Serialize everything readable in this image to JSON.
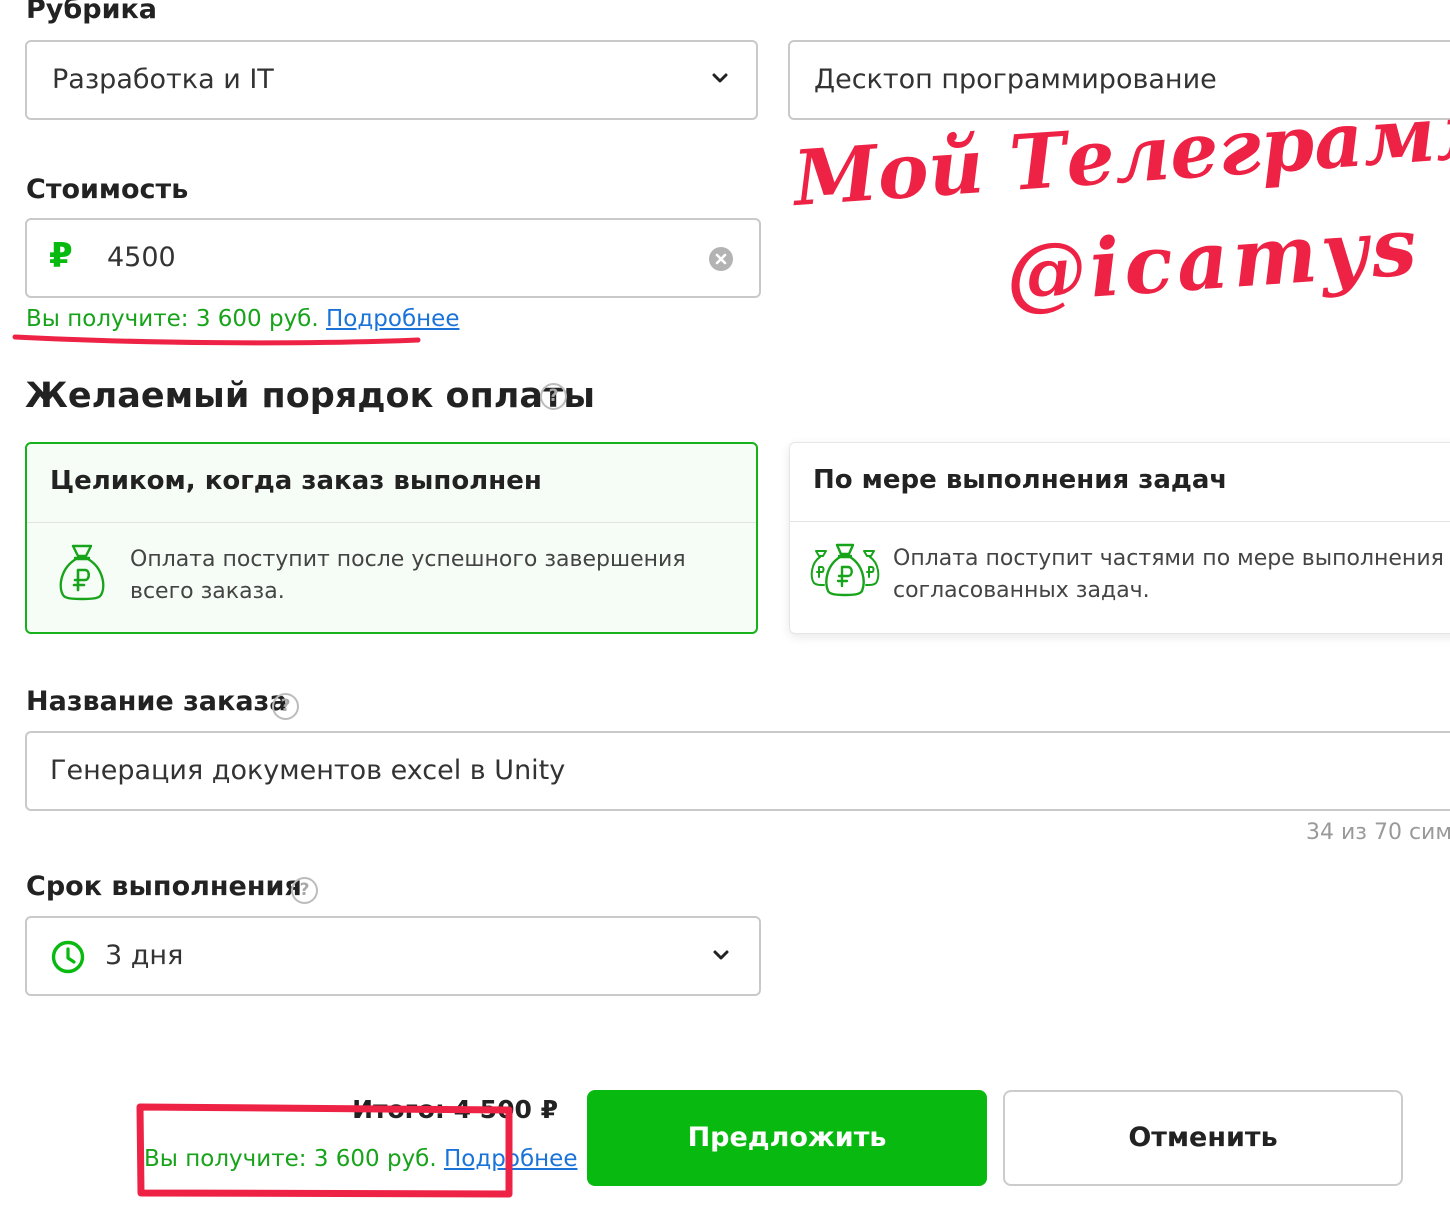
{
  "category": {
    "label": "Рубрика",
    "main_value": "Разработка и IT",
    "sub_value": "Десктоп программирование"
  },
  "price": {
    "label": "Стоимость",
    "currency_symbol": "₽",
    "value": "4500",
    "receive_text": "Вы получите: 3 600 руб.",
    "details_link": "Подробнее"
  },
  "payment": {
    "title": "Желаемый порядок оплаты",
    "help": "?",
    "options": [
      {
        "title": "Целиком, когда заказ выполнен",
        "description": "Оплата поступит после успешного завершения всего заказа.",
        "icon": "money-bag-icon",
        "selected": true
      },
      {
        "title": "По мере выполнения задач",
        "description": "Оплата поступит частями по мере выполнения согласованных задач.",
        "icon": "money-bags-icon",
        "selected": false
      }
    ]
  },
  "order_name": {
    "label": "Название заказа",
    "help": "?",
    "value": "Генерация документов excel в Unity",
    "counter": "34 из 70 сим"
  },
  "deadline": {
    "label": "Срок выполнения",
    "help": "?",
    "value": "3 дня"
  },
  "footer": {
    "total": "Итого:  4 500 ₽",
    "receive_text": "Вы получите: 3 600 руб.",
    "details_link": "Подробнее",
    "submit_label": "Предложить",
    "cancel_label": "Отменить"
  },
  "annotation": {
    "handwriting_line1": "Мой Телеграмм",
    "handwriting_line2": "@icamys"
  },
  "colors": {
    "accent_green": "#08b90f",
    "hint_green": "#17a31a",
    "link_blue": "#1a73d9",
    "annotation_red": "#ee2245"
  }
}
